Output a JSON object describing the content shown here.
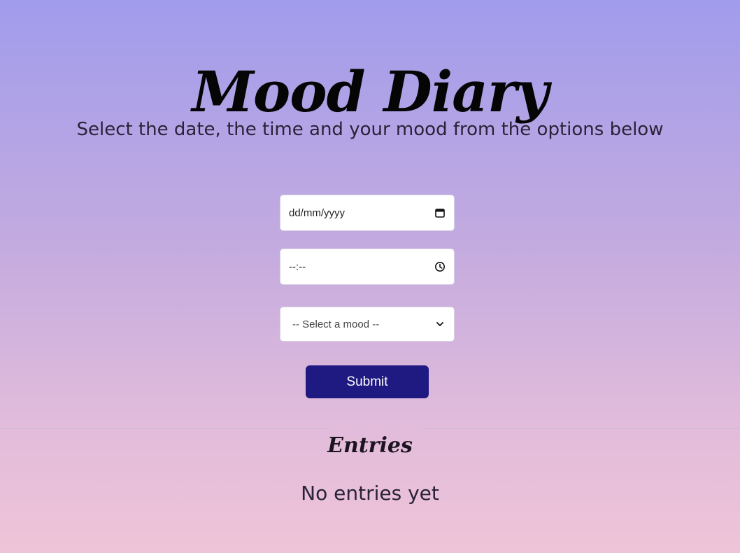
{
  "header": {
    "title": "Mood Diary",
    "subtitle": "Select the date, the time and your mood from the options below"
  },
  "form": {
    "date_placeholder": "dd/mm/yyyy",
    "date_icon": "calendar-icon",
    "time_placeholder": "--:--",
    "time_icon": "clock-icon",
    "mood_selected": "-- Select a mood --",
    "mood_icon": "chevron-down-icon",
    "submit_label": "Submit"
  },
  "entries": {
    "heading": "Entries",
    "empty_message": "No entries yet"
  },
  "colors": {
    "accent": "#1f1982",
    "gradient_top": "#a19cec",
    "gradient_bottom": "#efc4d8"
  }
}
